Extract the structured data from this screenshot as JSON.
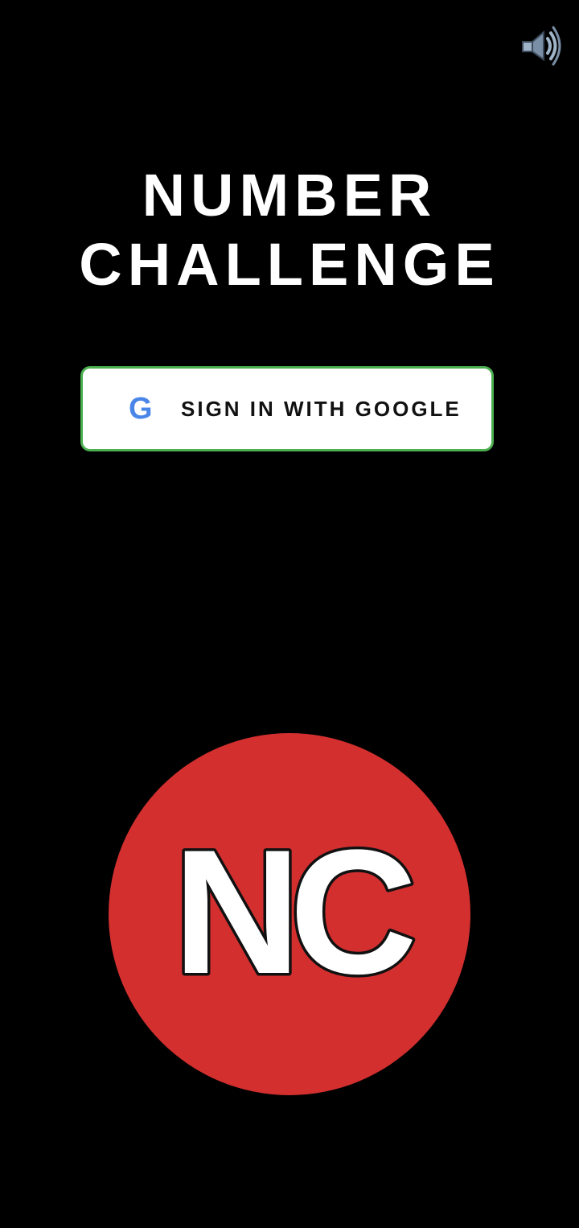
{
  "header": {
    "sound_icon": "speaker-volume-icon"
  },
  "title": {
    "line1": "NUMBER",
    "line2": "CHALLENGE"
  },
  "signin": {
    "google_icon_letter": "G",
    "label": "SIGN IN WITH GOOGLE"
  },
  "logo": {
    "text": "NC"
  },
  "colors": {
    "background": "#000000",
    "title_text": "#ffffff",
    "button_border": "#4caf50",
    "google_blue": "#4a86e8",
    "logo_red": "#d32f2f"
  }
}
